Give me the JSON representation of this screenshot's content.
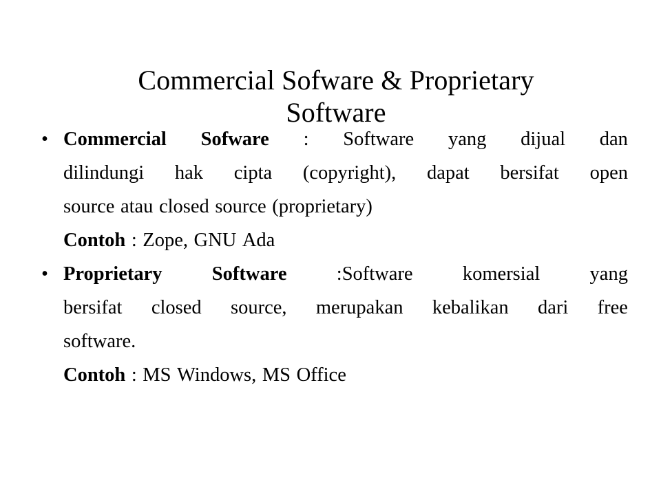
{
  "slide": {
    "background_color": "#ffffff",
    "text_color": "#000000",
    "title": {
      "line1": "Commercial Sofware & Proprietary",
      "line2": "Software"
    },
    "content": [
      {
        "type": "bullet",
        "bullet_glyph": "•",
        "lines": [
          {
            "justified": true,
            "words": [
              {
                "text": "Commercial",
                "bold": true
              },
              {
                "text": "Sofware",
                "bold": true
              },
              {
                "text": ":",
                "bold": false
              },
              {
                "text": "Software",
                "bold": false
              },
              {
                "text": "yang",
                "bold": false
              },
              {
                "text": "dijual",
                "bold": false
              },
              {
                "text": "dan",
                "bold": false
              }
            ]
          },
          {
            "justified": true,
            "words": [
              {
                "text": "dilindungi",
                "bold": false
              },
              {
                "text": "hak",
                "bold": false
              },
              {
                "text": "cipta",
                "bold": false
              },
              {
                "text": "(copyright),",
                "bold": false
              },
              {
                "text": "dapat",
                "bold": false
              },
              {
                "text": "bersifat",
                "bold": false
              },
              {
                "text": "open",
                "bold": false
              }
            ]
          },
          {
            "justified": false,
            "words": [
              {
                "text": "source",
                "bold": false
              },
              {
                "text": "atau",
                "bold": false
              },
              {
                "text": "closed",
                "bold": false
              },
              {
                "text": "source",
                "bold": false
              },
              {
                "text": "(proprietary)",
                "bold": false
              }
            ]
          }
        ]
      },
      {
        "type": "plain",
        "bullet_glyph": "",
        "lines": [
          {
            "justified": false,
            "words": [
              {
                "text": "Contoh",
                "bold": true
              },
              {
                "text": ":",
                "bold": false
              },
              {
                "text": "Zope,",
                "bold": false
              },
              {
                "text": "GNU",
                "bold": false
              },
              {
                "text": "Ada",
                "bold": false
              }
            ]
          }
        ]
      },
      {
        "type": "bullet",
        "bullet_glyph": "•",
        "lines": [
          {
            "justified": true,
            "words": [
              {
                "text": "Proprietary",
                "bold": true
              },
              {
                "text": "Software",
                "bold": true
              },
              {
                "text": ":Software",
                "bold": false
              },
              {
                "text": "komersial",
                "bold": false
              },
              {
                "text": "yang",
                "bold": false
              }
            ]
          },
          {
            "justified": true,
            "words": [
              {
                "text": "bersifat",
                "bold": false
              },
              {
                "text": "closed",
                "bold": false
              },
              {
                "text": "source,",
                "bold": false
              },
              {
                "text": "merupakan",
                "bold": false
              },
              {
                "text": "kebalikan",
                "bold": false
              },
              {
                "text": "dari",
                "bold": false
              },
              {
                "text": "free",
                "bold": false
              }
            ]
          },
          {
            "justified": false,
            "words": [
              {
                "text": "software.",
                "bold": false
              }
            ]
          }
        ]
      },
      {
        "type": "plain",
        "bullet_glyph": "",
        "lines": [
          {
            "justified": false,
            "words": [
              {
                "text": "Contoh",
                "bold": true
              },
              {
                "text": ":",
                "bold": false
              },
              {
                "text": "MS",
                "bold": false
              },
              {
                "text": "Windows,",
                "bold": false
              },
              {
                "text": "MS",
                "bold": false
              },
              {
                "text": "Office",
                "bold": false
              }
            ]
          }
        ]
      }
    ]
  }
}
